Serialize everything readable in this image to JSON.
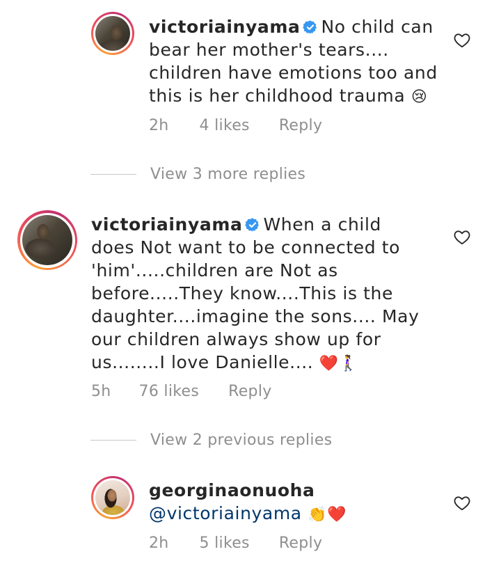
{
  "comments": [
    {
      "username": "victoriainyama",
      "verified": true,
      "text": "No child can bear her mother's tears.... children have emotions too and this is her childhood trauma",
      "emoji": "😢",
      "time": "2h",
      "likes": "4 likes",
      "reply_label": "Reply"
    },
    {
      "username": "victoriainyama",
      "verified": true,
      "text": "When a child does Not want to be connected to 'him'.....children are Not as before.....They know....This is the daughter....imagine the sons.... May our children always show up for us........I love Danielle....",
      "emoji": "❤️🚶‍♀️",
      "time": "5h",
      "likes": "76 likes",
      "reply_label": "Reply"
    },
    {
      "username": "georginaonuoha",
      "verified": false,
      "mention": "@victoriainyama",
      "emoji": "👏❤️",
      "time": "2h",
      "likes": "5 likes",
      "reply_label": "Reply"
    }
  ],
  "view_more_replies": "View 3 more replies",
  "view_previous_replies": "View 2 previous replies",
  "colors": {
    "text": "#262626",
    "secondary": "#8e8e8e",
    "verified_badge": "#3897f0",
    "mention": "#00376b",
    "heart_emoji": "#e0262b"
  },
  "icons": {
    "like": "heart-outline-icon",
    "verified": "verified-badge-icon"
  }
}
